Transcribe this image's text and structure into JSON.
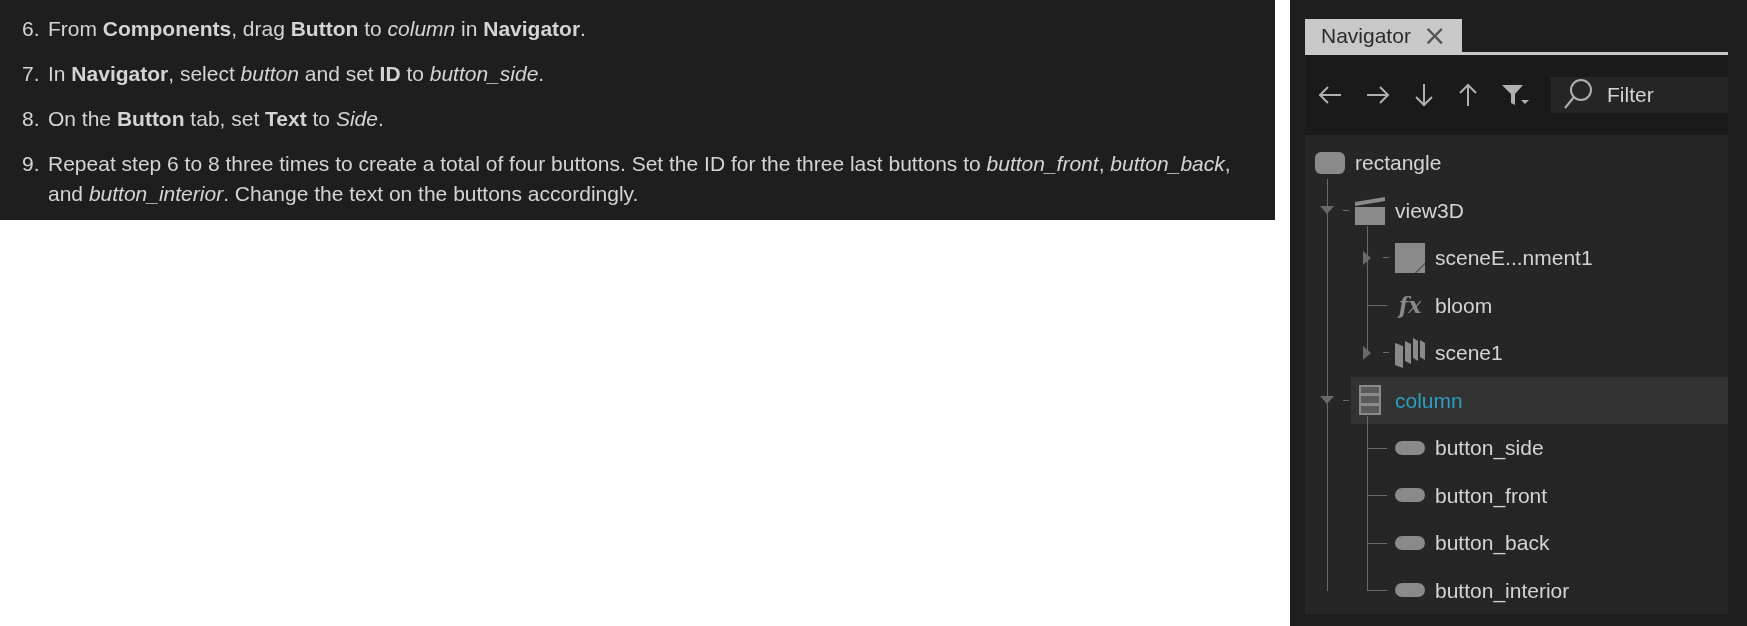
{
  "steps": [
    {
      "number": "6.",
      "text": "From **Components**, drag **Button** to *column* in **Navigator**."
    },
    {
      "number": "7.",
      "text": "In **Navigator**, select *button* and set **ID** to *button_side*."
    },
    {
      "number": "8.",
      "text": "On the **Button** tab, set **Text** to *Side*."
    },
    {
      "number": "9.",
      "text": "Repeat step 6 to 8 three times to create a total of four buttons. Set the ID for the three last buttons to *button_front*, *button_back*, and *button_interior*. Change the text on the buttons accordingly."
    }
  ],
  "navigator": {
    "tab": {
      "label": "Navigator",
      "close": "×"
    },
    "filter": {
      "placeholder": "Filter"
    },
    "tree": [
      {
        "label": "rectangle",
        "kind": "rectangle",
        "selected": false,
        "children": [
          {
            "label": "view3D",
            "kind": "view3d",
            "selected": false,
            "expanded": true,
            "children": [
              {
                "label": "sceneE...nment1",
                "kind": "environment",
                "selected": false,
                "expanded": false
              },
              {
                "label": "bloom",
                "kind": "effect",
                "glyph": "fx",
                "selected": false
              },
              {
                "label": "scene1",
                "kind": "scene",
                "selected": false,
                "expanded": false
              }
            ]
          },
          {
            "label": "column",
            "kind": "column",
            "selected": true,
            "expanded": true,
            "children": [
              {
                "label": "button_side",
                "kind": "button",
                "selected": false
              },
              {
                "label": "button_front",
                "kind": "button",
                "selected": false
              },
              {
                "label": "button_back",
                "kind": "button",
                "selected": false
              },
              {
                "label": "button_interior",
                "kind": "button",
                "selected": false
              }
            ]
          }
        ]
      }
    ]
  }
}
